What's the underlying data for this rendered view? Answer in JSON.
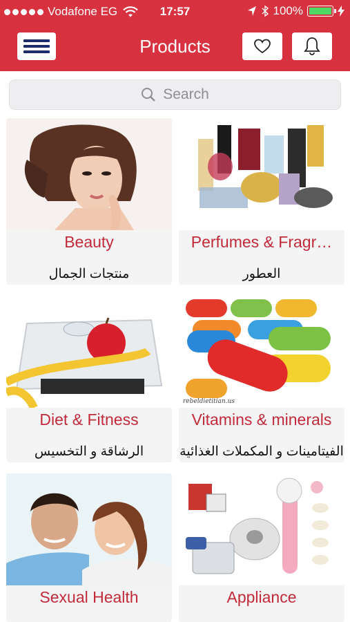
{
  "status_bar": {
    "carrier": "Vodafone EG",
    "time": "17:57",
    "battery": "100%",
    "battery_level": 1.0,
    "icons": [
      "signal-dots-icon",
      "wifi-icon",
      "location-icon",
      "bluetooth-icon",
      "battery-icon",
      "charging-icon"
    ]
  },
  "nav": {
    "title": "Products",
    "menu_icon": "hamburger-icon",
    "favorite_icon": "heart-icon",
    "notification_icon": "bell-icon"
  },
  "search": {
    "placeholder": "Search",
    "icon": "search-icon"
  },
  "categories": [
    {
      "name_en": "Beauty",
      "name_ar": "منتجات الجمال",
      "image": "woman-portrait-image"
    },
    {
      "name_en": "Perfumes & Fragr…",
      "name_ar": "العطور",
      "image": "perfume-bottles-image"
    },
    {
      "name_en": "Diet & Fitness",
      "name_ar": "الرشاقة و التخسيس",
      "image": "scale-apple-tape-image"
    },
    {
      "name_en": "Vitamins & minerals",
      "name_ar": "الفيتامينات و المكملات الغذائية",
      "image": "vitamin-capsules-image",
      "image_caption": "rebeldietitian.us"
    },
    {
      "name_en": "Sexual Health",
      "name_ar": "",
      "image": "couple-image"
    },
    {
      "name_en": "Appliance",
      "name_ar": "",
      "image": "appliances-image"
    }
  ],
  "colors": {
    "brand_red": "#d8313f",
    "label_red": "#c22a3a",
    "menu_blue": "#1d2a6b",
    "battery_green": "#4cd964"
  }
}
